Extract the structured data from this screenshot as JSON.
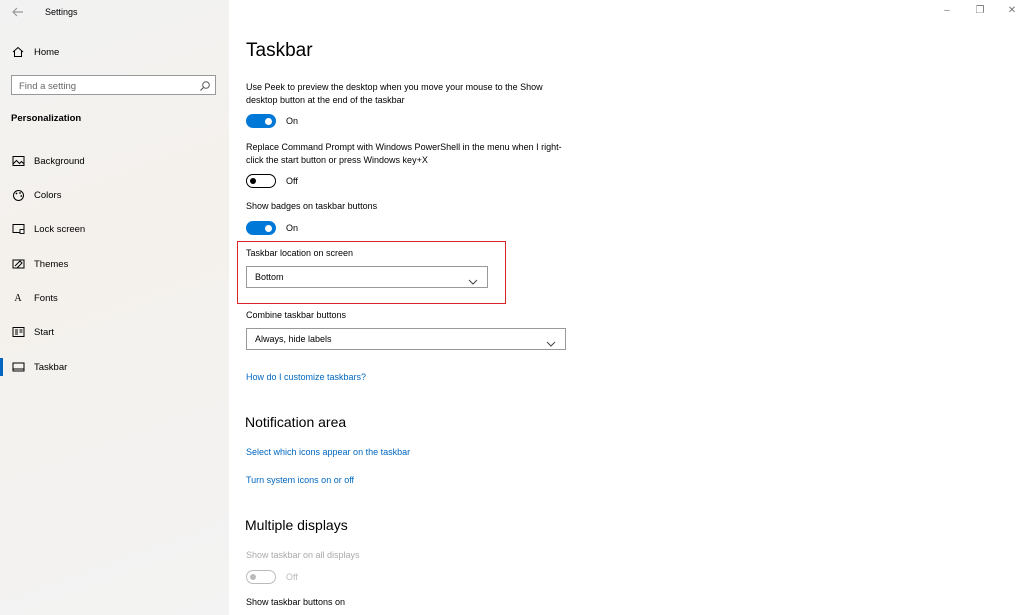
{
  "window": {
    "title": "Settings",
    "controls": {
      "minimize": "–",
      "restore": "❐",
      "close": "✕"
    }
  },
  "sidebar": {
    "home_label": "Home",
    "search_placeholder": "Find a setting",
    "section_label": "Personalization",
    "items": [
      {
        "label": "Background",
        "icon": "image-icon"
      },
      {
        "label": "Colors",
        "icon": "palette-icon"
      },
      {
        "label": "Lock screen",
        "icon": "lock-screen-icon"
      },
      {
        "label": "Themes",
        "icon": "themes-icon"
      },
      {
        "label": "Fonts",
        "icon": "fonts-icon"
      },
      {
        "label": "Start",
        "icon": "start-icon"
      },
      {
        "label": "Taskbar",
        "icon": "taskbar-icon",
        "active": true
      }
    ]
  },
  "main": {
    "title": "Taskbar",
    "peek": {
      "text": "Use Peek to preview the desktop when you move your mouse to the Show desktop button at the end of the taskbar",
      "state": "On"
    },
    "powershell": {
      "text": "Replace Command Prompt with Windows PowerShell in the menu when I right-click the start button or press Windows key+X",
      "state": "Off"
    },
    "badges": {
      "text": "Show badges on taskbar buttons",
      "state": "On"
    },
    "location": {
      "label": "Taskbar location on screen",
      "value": "Bottom"
    },
    "combine": {
      "label": "Combine taskbar buttons",
      "value": "Always, hide labels"
    },
    "customize_link": "How do I customize taskbars?",
    "notification": {
      "title": "Notification area",
      "link1": "Select which icons appear on the taskbar",
      "link2": "Turn system icons on or off"
    },
    "multiple": {
      "title": "Multiple displays",
      "show_all_text": "Show taskbar on all displays",
      "show_all_state": "Off",
      "buttons_on_label": "Show taskbar buttons on"
    }
  },
  "colors": {
    "accent": "#0078d7",
    "highlight": "#d9262a",
    "link": "#0067c0"
  }
}
